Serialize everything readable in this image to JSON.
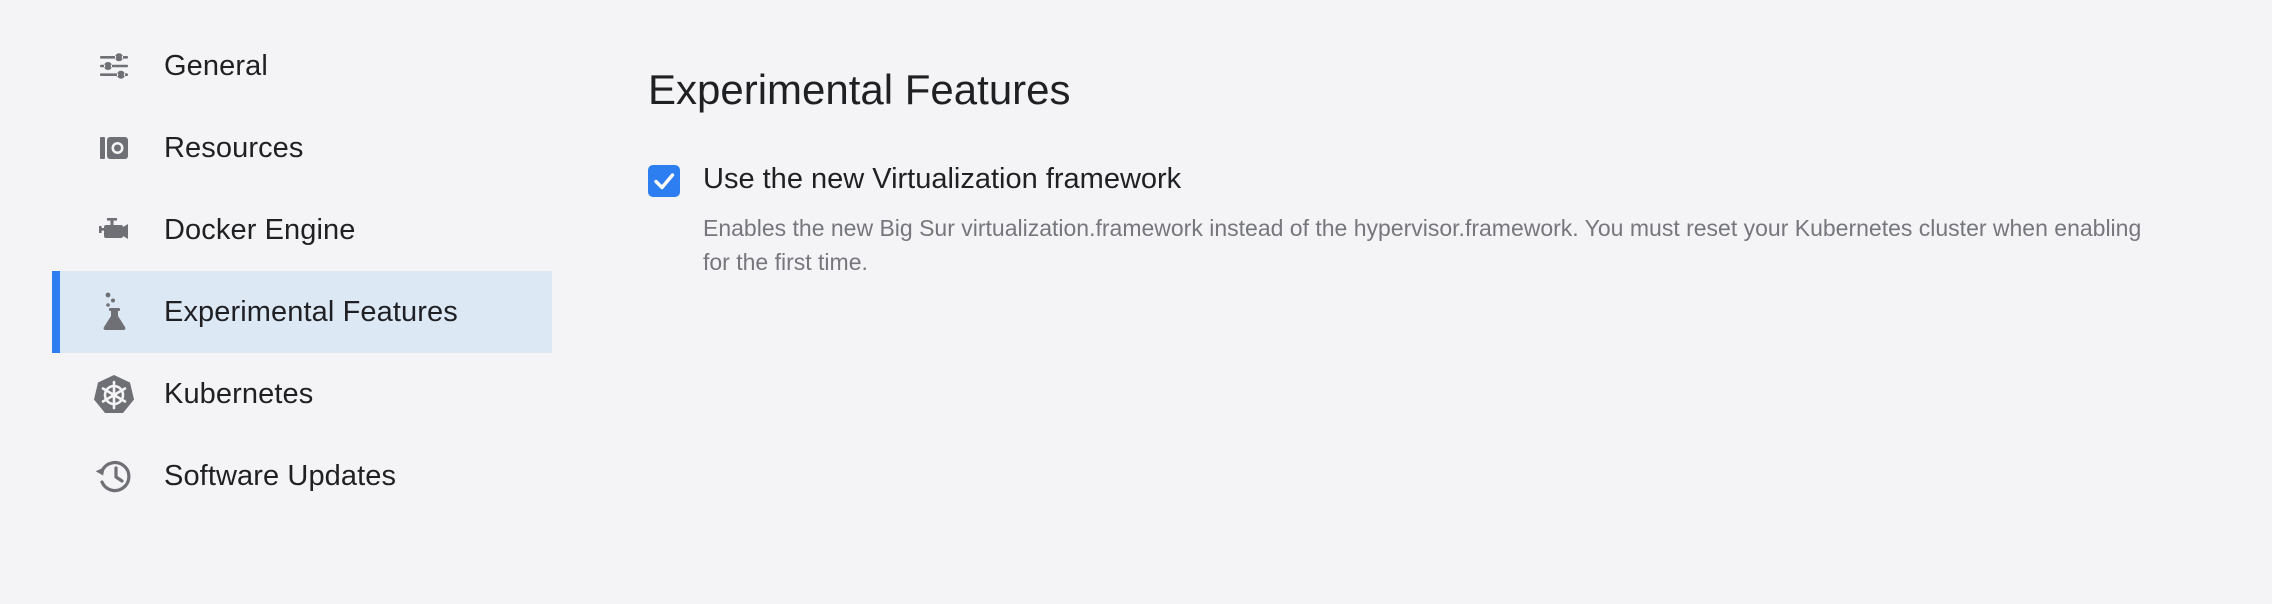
{
  "sidebar": {
    "items": [
      {
        "label": "General",
        "icon": "sliders-icon",
        "active": false
      },
      {
        "label": "Resources",
        "icon": "disk-icon",
        "active": false
      },
      {
        "label": "Docker Engine",
        "icon": "engine-icon",
        "active": false
      },
      {
        "label": "Experimental Features",
        "icon": "flask-icon",
        "active": true
      },
      {
        "label": "Kubernetes",
        "icon": "kubernetes-icon",
        "active": false
      },
      {
        "label": "Software Updates",
        "icon": "history-icon",
        "active": false
      }
    ]
  },
  "main": {
    "title": "Experimental Features",
    "option": {
      "label": "Use the new Virtualization framework",
      "checked": true,
      "description": "Enables the new Big Sur virtualization.framework instead of the hypervisor.framework. You must reset your Kubernetes cluster when enabling for the first time."
    }
  },
  "colors": {
    "accent": "#2d7ef0",
    "active_bg": "#dde8f5",
    "background": "#f4f4f6",
    "icon": "#6f7075",
    "description": "#76777d"
  }
}
